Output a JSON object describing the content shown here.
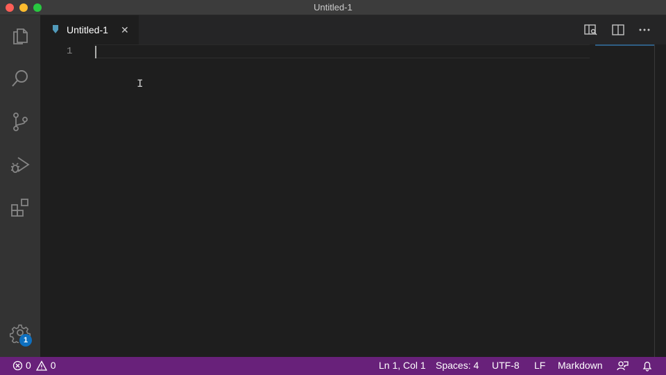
{
  "window": {
    "title": "Untitled-1"
  },
  "activity_bar": {
    "items": [
      {
        "name": "explorer",
        "icon": "files-icon"
      },
      {
        "name": "search",
        "icon": "search-icon"
      },
      {
        "name": "source-control",
        "icon": "source-control-icon"
      },
      {
        "name": "run-debug",
        "icon": "run-debug-icon"
      },
      {
        "name": "extensions",
        "icon": "extensions-icon"
      }
    ],
    "manage": {
      "icon": "gear-icon",
      "badge": "1"
    }
  },
  "tabs": [
    {
      "label": "Untitled-1",
      "close": "✕",
      "icon": "markdown-icon",
      "active": true
    }
  ],
  "editor": {
    "lines": [
      {
        "number": "1",
        "text": ""
      }
    ]
  },
  "status_bar": {
    "errors": "0",
    "warnings": "0",
    "position": "Ln 1, Col 1",
    "indentation": "Spaces: 4",
    "encoding": "UTF-8",
    "eol": "LF",
    "language": "Markdown",
    "color": "#68217a"
  },
  "colors": {
    "accent": "#0e70c0",
    "status_bar": "#68217a",
    "tab_active_text": "#ffffff"
  }
}
